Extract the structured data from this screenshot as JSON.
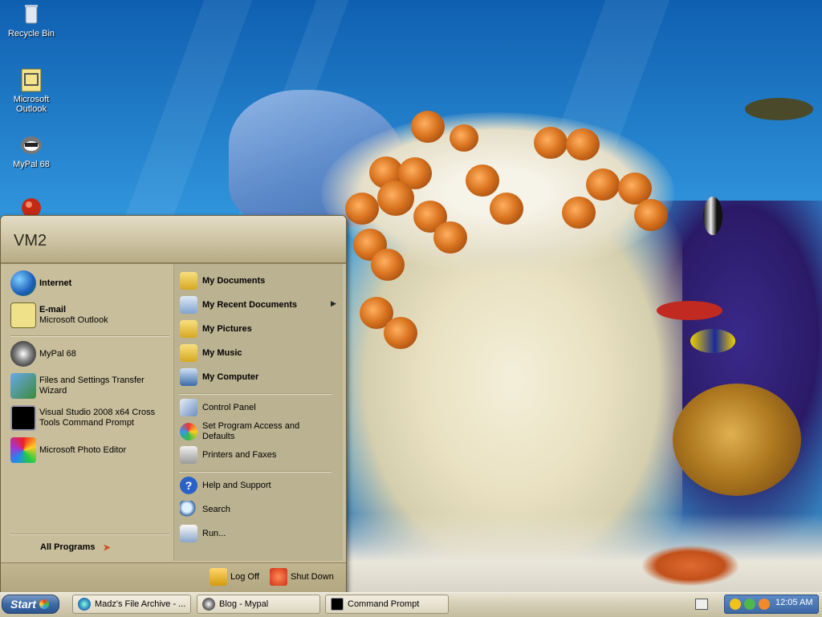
{
  "desktop": {
    "icons": [
      {
        "label": "Recycle Bin",
        "icon": "recycle-bin-icon"
      },
      {
        "label": "Microsoft\nOutlook",
        "icon": "outlook-icon"
      },
      {
        "label": "MyPal 68",
        "icon": "mypal-icon"
      },
      {
        "label": "",
        "icon": "red-orb-icon"
      }
    ]
  },
  "start_menu": {
    "user": "VM2",
    "pinned": [
      {
        "title": "Internet",
        "subtitle": "",
        "icon": "globe-icon"
      },
      {
        "title": "E-mail",
        "subtitle": "Microsoft Outlook",
        "icon": "outlook-icon"
      }
    ],
    "recent": [
      {
        "label": "MyPal 68",
        "icon": "mypal-icon"
      },
      {
        "label": "Files and Settings Transfer Wizard",
        "icon": "transfer-wizard-icon"
      },
      {
        "label": "Visual Studio 2008 x64 Cross Tools Command Prompt",
        "icon": "command-prompt-icon"
      },
      {
        "label": "Microsoft Photo Editor",
        "icon": "photo-editor-icon"
      }
    ],
    "all_programs": "All Programs",
    "places": [
      {
        "label": "My Documents",
        "icon": "folder-documents-icon"
      },
      {
        "label": "My Recent Documents",
        "icon": "recent-documents-icon"
      },
      {
        "label": "My Pictures",
        "icon": "folder-pictures-icon"
      },
      {
        "label": "My Music",
        "icon": "folder-music-icon"
      },
      {
        "label": "My Computer",
        "icon": "computer-icon"
      }
    ],
    "system": [
      {
        "label": "Control Panel",
        "icon": "control-panel-icon"
      },
      {
        "label": "Set Program Access and Defaults",
        "icon": "program-defaults-icon"
      },
      {
        "label": "Printers and Faxes",
        "icon": "printer-icon"
      }
    ],
    "help": [
      {
        "label": "Help and Support",
        "icon": "help-icon"
      },
      {
        "label": "Search",
        "icon": "search-icon"
      },
      {
        "label": "Run...",
        "icon": "run-icon"
      }
    ],
    "footer": {
      "log_off": "Log Off",
      "shut_down": "Shut Down"
    }
  },
  "taskbar": {
    "start": "Start",
    "tasks": [
      {
        "label": "Madz's File Archive - ...",
        "icon": "browser-icon"
      },
      {
        "label": "Blog - Mypal",
        "icon": "mypal-icon"
      },
      {
        "label": "Command Prompt",
        "icon": "command-prompt-icon"
      }
    ],
    "clock": "12:05 AM"
  }
}
